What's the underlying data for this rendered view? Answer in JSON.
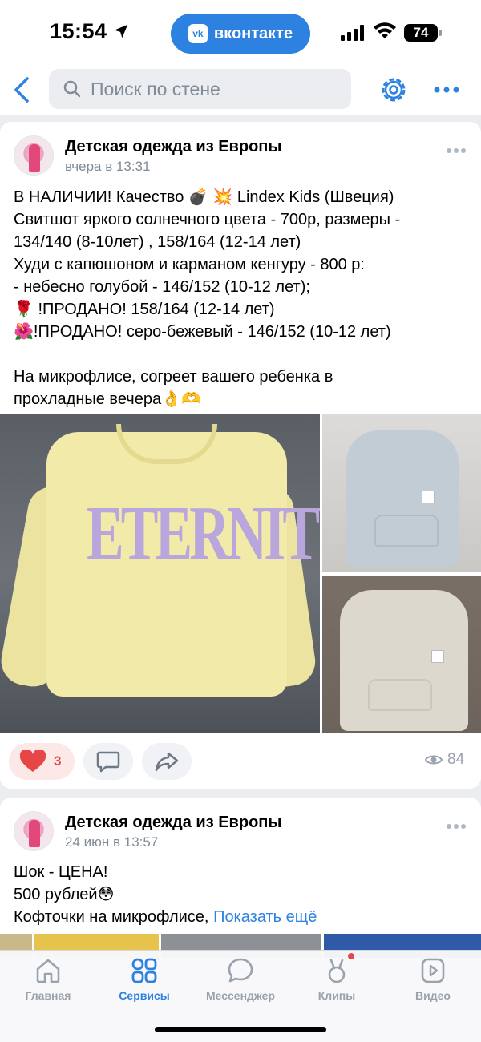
{
  "status_bar": {
    "time": "15:54",
    "app_pill": "вконтакте",
    "vk_logo": "vk",
    "battery": "74"
  },
  "top_nav": {
    "search_placeholder": "Поиск по стене"
  },
  "posts": [
    {
      "author": "Детская одежда из Европы",
      "date": "вчера в 13:31",
      "lines": [
        "В НАЛИЧИИ! Качество 💣 💥 Lindex Kids (Швеция)",
        "Свитшот яркого солнечного цвета - 700р, размеры -",
        "134/140 (8-10лет) , 158/164 (12-14 лет)",
        "Худи с капюшоном и карманом кенгуру - 800 р:",
        "- небесно голубой - 146/152 (10-12 лет);",
        "🌹 !ПРОДАНО! 158/164 (12-14 лет)",
        "🌺!ПРОДАНО! серо-бежевый - 146/152 (10-12 лет)",
        "",
        "На микрофлисе, согреет вашего ребенка в",
        "прохладные вечера👌🫶"
      ],
      "photo_print": "ETERNITY",
      "likes": "3",
      "views": "84"
    },
    {
      "author": "Детская одежда из Европы",
      "date": "24 июн в 13:57",
      "lines": [
        "Шок - ЦЕНА!",
        "500 рублей😳"
      ],
      "last_line": "Кофточки на микрофлисе,",
      "show_more": "Показать ещё"
    }
  ],
  "tabbar": {
    "tabs": [
      {
        "label": "Главная",
        "icon": "home-icon"
      },
      {
        "label": "Сервисы",
        "icon": "services-icon"
      },
      {
        "label": "Мессенджер",
        "icon": "messenger-icon"
      },
      {
        "label": "Клипы",
        "icon": "clips-icon"
      },
      {
        "label": "Видео",
        "icon": "video-icon"
      }
    ],
    "active_index": 1
  },
  "colors": {
    "accent": "#2d81e0",
    "like": "#e64646",
    "secondary_text": "#818c99",
    "background": "#ebedf0"
  }
}
